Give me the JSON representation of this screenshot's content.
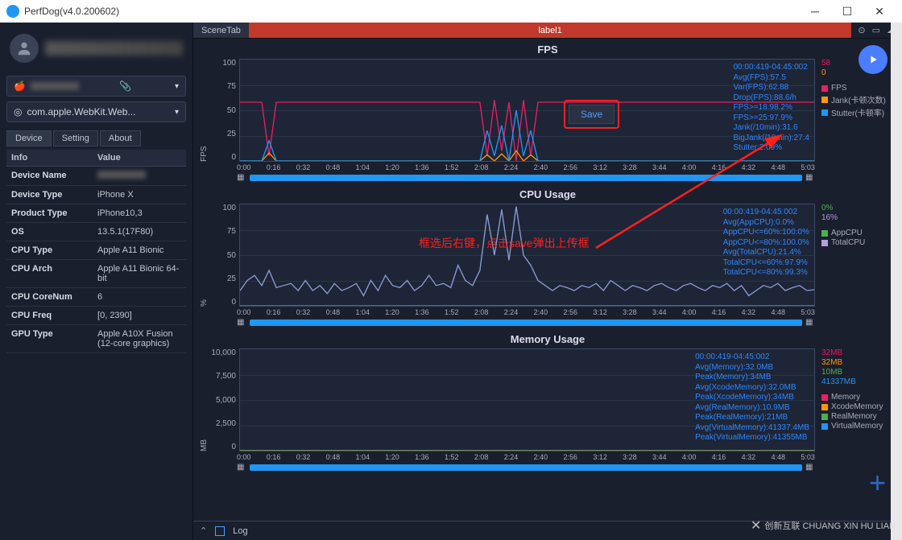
{
  "window": {
    "title": "PerfDog(v4.0.200602)"
  },
  "sidebar": {
    "device_dropdown": "",
    "app_dropdown": "com.apple.WebKit.Web...",
    "tabs": {
      "device": "Device",
      "setting": "Setting",
      "about": "About"
    },
    "table_header": {
      "info": "Info",
      "value": "Value"
    },
    "rows": [
      {
        "k": "Device Name",
        "v": ""
      },
      {
        "k": "Device Type",
        "v": "iPhone X"
      },
      {
        "k": "Product Type",
        "v": "iPhone10,3"
      },
      {
        "k": "OS",
        "v": "13.5.1(17F80)"
      },
      {
        "k": "CPU Type",
        "v": "Apple A11 Bionic"
      },
      {
        "k": "CPU Arch",
        "v": "Apple A11 Bionic 64-bit"
      },
      {
        "k": "CPU CoreNum",
        "v": "6"
      },
      {
        "k": "CPU Freq",
        "v": "[0, 2390]"
      },
      {
        "k": "GPU Type",
        "v": "Apple A10X Fusion (12-core graphics)"
      }
    ]
  },
  "scene": {
    "scenetab": "SceneTab",
    "label1": "label1"
  },
  "save_popup": {
    "label": "Save"
  },
  "annotation": "框选后右键，点击save弹出上传框",
  "bottom": {
    "log": "Log"
  },
  "chart_data": [
    {
      "type": "line",
      "title": "FPS",
      "ylabel": "FPS",
      "ylim": [
        0,
        100
      ],
      "yticks": [
        0,
        25,
        50,
        75,
        100
      ],
      "xticks": [
        "0:00",
        "0:16",
        "0:32",
        "0:48",
        "1:04",
        "1:20",
        "1:36",
        "1:52",
        "2:08",
        "2:24",
        "2:40",
        "2:56",
        "3:12",
        "3:28",
        "3:44",
        "4:00",
        "4:16",
        "4:32",
        "4:48",
        "5:03"
      ],
      "overlay_lines": [
        "00:00:419-04:45:002",
        "Avg(FPS):57.5",
        "Var(FPS):62.88",
        "Drop(FPS):88.6/h",
        "FPS>=18:98.2%",
        "FPS>=25:97.9%",
        "Jank(/10min):31.6",
        "BigJank(/10min):27.4",
        "Stutter:2.09%"
      ],
      "legend_stats": [
        {
          "text": "58",
          "color": "#e91e63"
        },
        {
          "text": "0",
          "color": "#ff9800"
        }
      ],
      "legend": [
        {
          "name": "FPS",
          "color": "#e91e63"
        },
        {
          "name": "Jank(卡顿次数)",
          "color": "#ff9800"
        },
        {
          "name": "Stutter(卡顿率)",
          "color": "#2196f3"
        }
      ],
      "series": [
        {
          "name": "FPS",
          "color": "#e91e63",
          "values": [
            58,
            58,
            58,
            58,
            5,
            58,
            58,
            58,
            58,
            58,
            58,
            58,
            58,
            58,
            58,
            58,
            58,
            58,
            58,
            58,
            58,
            58,
            58,
            58,
            58,
            58,
            58,
            58,
            58,
            58,
            58,
            58,
            58,
            58,
            5,
            60,
            10,
            58,
            0,
            60,
            5,
            58,
            58,
            58,
            58,
            58,
            58,
            58,
            58,
            58,
            58,
            58,
            58,
            58,
            58,
            58,
            58,
            58,
            58,
            58,
            58,
            58,
            58,
            58,
            58,
            58,
            58,
            58,
            58,
            58,
            58,
            58,
            58,
            58,
            58,
            58,
            58,
            58,
            58,
            58
          ]
        },
        {
          "name": "Jank",
          "color": "#ff9800",
          "values": [
            0,
            0,
            0,
            0,
            8,
            0,
            0,
            0,
            0,
            0,
            0,
            0,
            0,
            0,
            0,
            0,
            0,
            0,
            0,
            0,
            0,
            0,
            0,
            0,
            0,
            0,
            0,
            0,
            0,
            0,
            0,
            0,
            0,
            0,
            6,
            0,
            7,
            0,
            10,
            0,
            6,
            0,
            0,
            0,
            0,
            0,
            0,
            0,
            0,
            0,
            0,
            0,
            0,
            0,
            0,
            0,
            0,
            0,
            0,
            0,
            0,
            0,
            0,
            0,
            0,
            0,
            0,
            0,
            0,
            0,
            0,
            0,
            0,
            0,
            0,
            0,
            0,
            0,
            0,
            0
          ]
        },
        {
          "name": "Stutter",
          "color": "#2196f3",
          "values": [
            0,
            0,
            0,
            0,
            20,
            0,
            0,
            0,
            0,
            0,
            0,
            0,
            0,
            0,
            0,
            0,
            0,
            0,
            0,
            0,
            0,
            0,
            0,
            0,
            0,
            0,
            0,
            0,
            0,
            0,
            0,
            0,
            0,
            0,
            30,
            5,
            35,
            0,
            50,
            5,
            30,
            0,
            0,
            0,
            0,
            0,
            0,
            0,
            0,
            0,
            0,
            0,
            0,
            0,
            0,
            0,
            0,
            0,
            0,
            0,
            0,
            0,
            0,
            0,
            0,
            0,
            0,
            0,
            0,
            0,
            0,
            0,
            0,
            0,
            0,
            0,
            0,
            0,
            0,
            0
          ]
        }
      ]
    },
    {
      "type": "line",
      "title": "CPU Usage",
      "ylabel": "%",
      "ylim": [
        0,
        100
      ],
      "yticks": [
        0,
        25,
        50,
        75,
        100
      ],
      "xticks": [
        "0:00",
        "0:16",
        "0:32",
        "0:48",
        "1:04",
        "1:20",
        "1:36",
        "1:52",
        "2:08",
        "2:24",
        "2:40",
        "2:56",
        "3:12",
        "3:28",
        "3:44",
        "4:00",
        "4:16",
        "4:32",
        "4:48",
        "5:03"
      ],
      "overlay_lines": [
        "00:00:419-04:45:002",
        "Avg(AppCPU):0.0%",
        "AppCPU<=60%:100.0%",
        "AppCPU<=80%:100.0%",
        "Avg(TotalCPU):21.4%",
        "TotalCPU<=60%:97.9%",
        "TotalCPU<=80%:99.3%"
      ],
      "legend_stats": [
        {
          "text": "0%",
          "color": "#4caf50"
        },
        {
          "text": "16%",
          "color": "#b39ddb"
        }
      ],
      "legend": [
        {
          "name": "AppCPU",
          "color": "#4caf50"
        },
        {
          "name": "TotalCPU",
          "color": "#b39ddb"
        }
      ],
      "series": [
        {
          "name": "AppCPU",
          "color": "#4caf50",
          "values": [
            0,
            0,
            0,
            0,
            0,
            0,
            0,
            0,
            0,
            0,
            0,
            0,
            0,
            0,
            0,
            0,
            0,
            0,
            0,
            0,
            0,
            0,
            0,
            0,
            0,
            0,
            0,
            0,
            0,
            0,
            0,
            0,
            0,
            0,
            0,
            0,
            0,
            0,
            0,
            0,
            0,
            0,
            0,
            0,
            0,
            0,
            0,
            0,
            0,
            0,
            0,
            0,
            0,
            0,
            0,
            0,
            0,
            0,
            0,
            0,
            0,
            0,
            0,
            0,
            0,
            0,
            0,
            0,
            0,
            0,
            0,
            0,
            0,
            0,
            0,
            0,
            0,
            0,
            0,
            0
          ]
        },
        {
          "name": "TotalCPU",
          "color": "#8a9bd4",
          "values": [
            15,
            25,
            30,
            20,
            35,
            18,
            20,
            22,
            15,
            25,
            15,
            20,
            12,
            22,
            15,
            18,
            22,
            10,
            25,
            15,
            30,
            20,
            18,
            25,
            15,
            20,
            30,
            20,
            22,
            18,
            40,
            25,
            20,
            35,
            90,
            50,
            95,
            45,
            98,
            50,
            40,
            25,
            20,
            15,
            20,
            18,
            15,
            20,
            18,
            22,
            15,
            25,
            20,
            15,
            20,
            18,
            15,
            20,
            22,
            18,
            15,
            20,
            22,
            18,
            15,
            20,
            18,
            22,
            15,
            20,
            10,
            15,
            20,
            18,
            22,
            15,
            18,
            20,
            15,
            16
          ]
        }
      ]
    },
    {
      "type": "line",
      "title": "Memory Usage",
      "ylabel": "MB",
      "ylim": [
        0,
        10000
      ],
      "yticks": [
        0,
        2500,
        5000,
        7500,
        10000
      ],
      "xticks": [
        "0:00",
        "0:16",
        "0:32",
        "0:48",
        "1:04",
        "1:20",
        "1:36",
        "1:52",
        "2:08",
        "2:24",
        "2:40",
        "2:56",
        "3:12",
        "3:28",
        "3:44",
        "4:00",
        "4:16",
        "4:32",
        "4:48",
        "5:03"
      ],
      "overlay_lines": [
        "00:00:419-04:45:002",
        "Avg(Memory):32.0MB",
        "Peak(Memory):34MB",
        "Avg(XcodeMemory):32.0MB",
        "Peak(XcodeMemory):34MB",
        "Avg(RealMemory):10.9MB",
        "Peak(RealMemory):21MB",
        "Avg(VirtualMemory):41337.4MB",
        "Peak(VirtualMemory):41355MB"
      ],
      "legend_stats": [
        {
          "text": "32MB",
          "color": "#e91e63"
        },
        {
          "text": "32MB",
          "color": "#ff9800"
        },
        {
          "text": "10MB",
          "color": "#4caf50"
        },
        {
          "text": "41337MB",
          "color": "#2196f3"
        }
      ],
      "legend": [
        {
          "name": "Memory",
          "color": "#e91e63"
        },
        {
          "name": "XcodeMemory",
          "color": "#ff9800"
        },
        {
          "name": "RealMemory",
          "color": "#4caf50"
        },
        {
          "name": "VirtualMemory",
          "color": "#2196f3"
        }
      ],
      "series": [
        {
          "name": "Memory",
          "color": "#e91e63",
          "values": [
            32,
            32,
            32,
            32,
            32,
            32,
            32,
            32,
            32,
            32,
            32,
            32,
            32,
            32,
            32,
            32,
            32,
            32,
            32,
            32
          ]
        },
        {
          "name": "RealMemory",
          "color": "#4caf50",
          "values": [
            11,
            11,
            11,
            11,
            11,
            11,
            11,
            11,
            11,
            11,
            11,
            11,
            11,
            11,
            11,
            11,
            11,
            11,
            11,
            11
          ]
        }
      ]
    }
  ],
  "watermark": "创新互联 CHUANG XIN HU LIAN"
}
